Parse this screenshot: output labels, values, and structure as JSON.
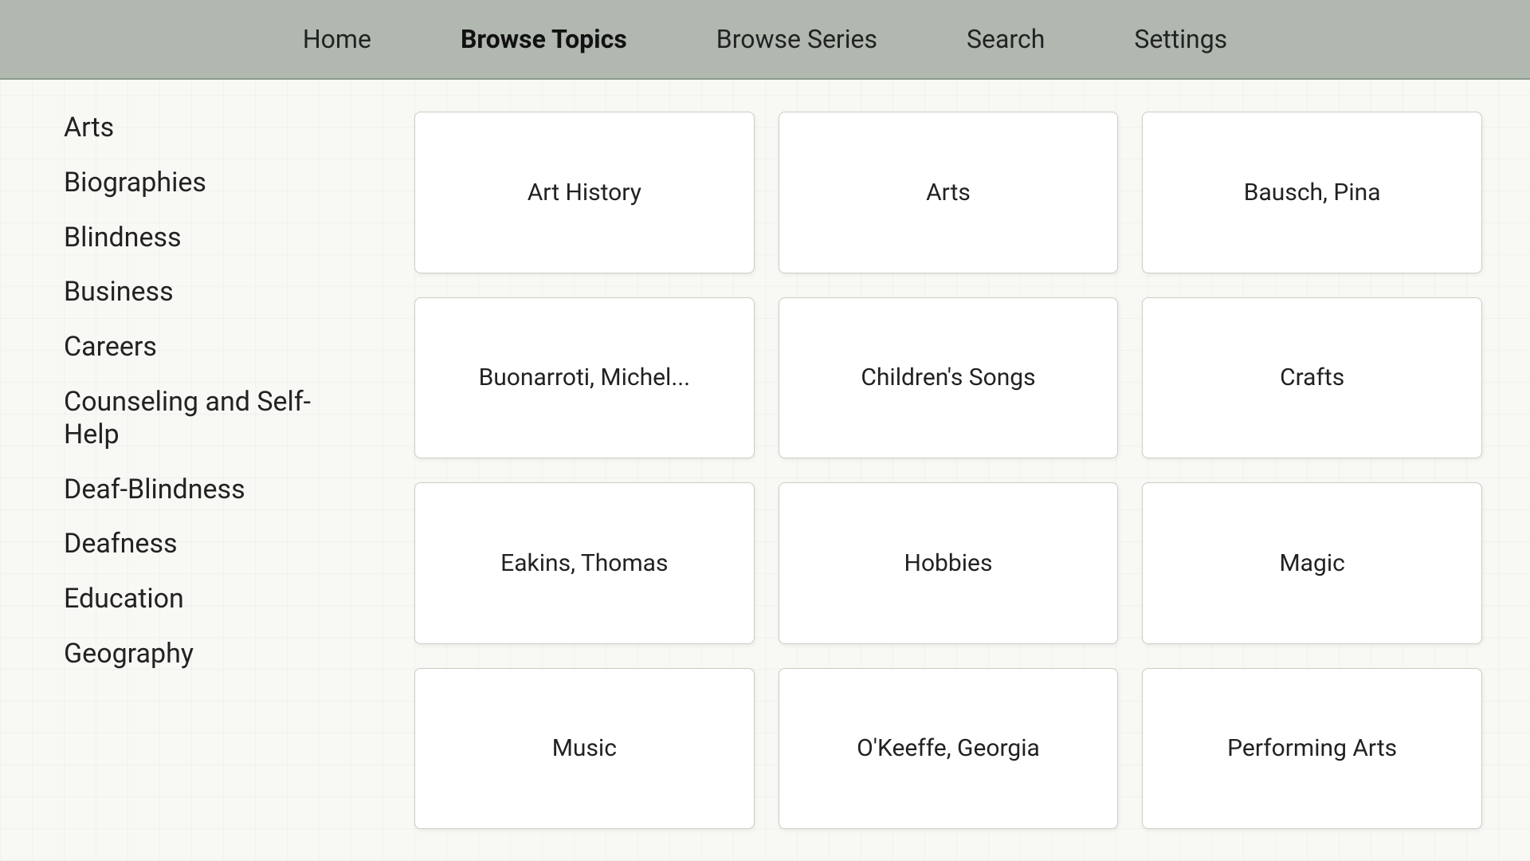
{
  "nav": {
    "items": [
      {
        "id": "home",
        "label": "Home",
        "active": false
      },
      {
        "id": "browse-topics",
        "label": "Browse Topics",
        "active": true
      },
      {
        "id": "browse-series",
        "label": "Browse Series",
        "active": false
      },
      {
        "id": "search",
        "label": "Search",
        "active": false
      },
      {
        "id": "settings",
        "label": "Settings",
        "active": false
      }
    ]
  },
  "sidebar": {
    "items": [
      {
        "id": "arts",
        "label": "Arts"
      },
      {
        "id": "biographies",
        "label": "Biographies"
      },
      {
        "id": "blindness",
        "label": "Blindness"
      },
      {
        "id": "business",
        "label": "Business"
      },
      {
        "id": "careers",
        "label": "Careers"
      },
      {
        "id": "counseling",
        "label": "Counseling and Self-Help"
      },
      {
        "id": "deaf-blindness",
        "label": "Deaf-Blindness"
      },
      {
        "id": "deafness",
        "label": "Deafness"
      },
      {
        "id": "education",
        "label": "Education"
      },
      {
        "id": "geography",
        "label": "Geography"
      }
    ]
  },
  "grid": {
    "cards": [
      {
        "id": "art-history",
        "label": "Art History"
      },
      {
        "id": "arts",
        "label": "Arts"
      },
      {
        "id": "bausch-pina",
        "label": "Bausch, Pina"
      },
      {
        "id": "buonarroti",
        "label": "Buonarroti, Michel..."
      },
      {
        "id": "childrens-songs",
        "label": "Children's Songs"
      },
      {
        "id": "crafts",
        "label": "Crafts"
      },
      {
        "id": "eakins-thomas",
        "label": "Eakins, Thomas"
      },
      {
        "id": "hobbies",
        "label": "Hobbies"
      },
      {
        "id": "magic",
        "label": "Magic"
      },
      {
        "id": "music",
        "label": "Music"
      },
      {
        "id": "okeeffe-georgia",
        "label": "O'Keeffe, Georgia"
      },
      {
        "id": "performing-arts",
        "label": "Performing Arts"
      }
    ]
  }
}
